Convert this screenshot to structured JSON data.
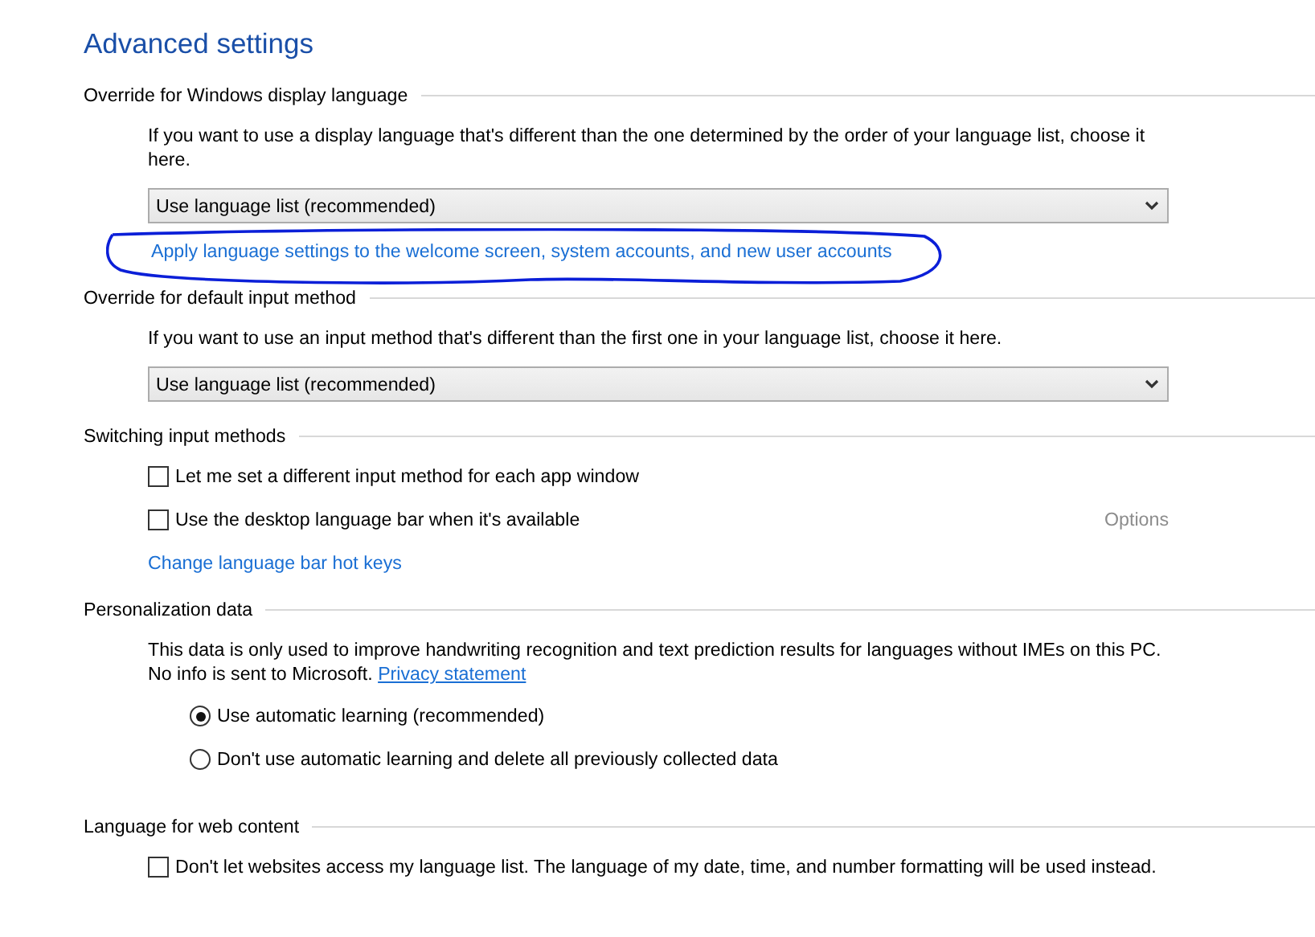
{
  "title": "Advanced settings",
  "sections": [
    {
      "heading": "Override for Windows display language",
      "items": [
        {
          "kind": "text",
          "text": "If you want to use a display language that's different than the one determined by the order of your language list, choose it here."
        },
        {
          "kind": "dropdown",
          "value": "Use language list (recommended)"
        },
        {
          "kind": "link",
          "text": "Apply language settings to the welcome screen, system accounts, and new user accounts"
        }
      ]
    },
    {
      "heading": "Override for default input method",
      "items": [
        {
          "kind": "text",
          "text": "If you want to use an input method that's different than the first one in your language list, choose it here."
        },
        {
          "kind": "dropdown",
          "value": "Use language list (recommended)"
        }
      ]
    },
    {
      "heading": "Switching input methods",
      "items": [
        {
          "kind": "checkbox",
          "label": "Let me set a different input method for each app window",
          "checked": false
        },
        {
          "kind": "checkbox",
          "label": "Use the desktop language bar when it's available",
          "checked": false,
          "option": {
            "label": "Options",
            "disabled": true
          }
        },
        {
          "kind": "link",
          "text": "Change language bar hot keys"
        }
      ]
    },
    {
      "heading": "Personalization data",
      "items": [
        {
          "kind": "text",
          "text": "This data is only used to improve handwriting recognition and text prediction results for languages without IMEs on this PC. No info is sent to Microsoft.",
          "link": "Privacy statement"
        },
        {
          "kind": "radio",
          "label": "Use automatic learning (recommended)",
          "selected": true
        },
        {
          "kind": "radio",
          "label": "Don't use automatic learning and delete all previously collected data",
          "selected": false
        }
      ]
    },
    {
      "heading": "Language for web content",
      "items": [
        {
          "kind": "checkbox",
          "label": "Don't let websites access my language list. The language of my date, time, and number formatting will be used instead.",
          "checked": false
        }
      ]
    }
  ]
}
